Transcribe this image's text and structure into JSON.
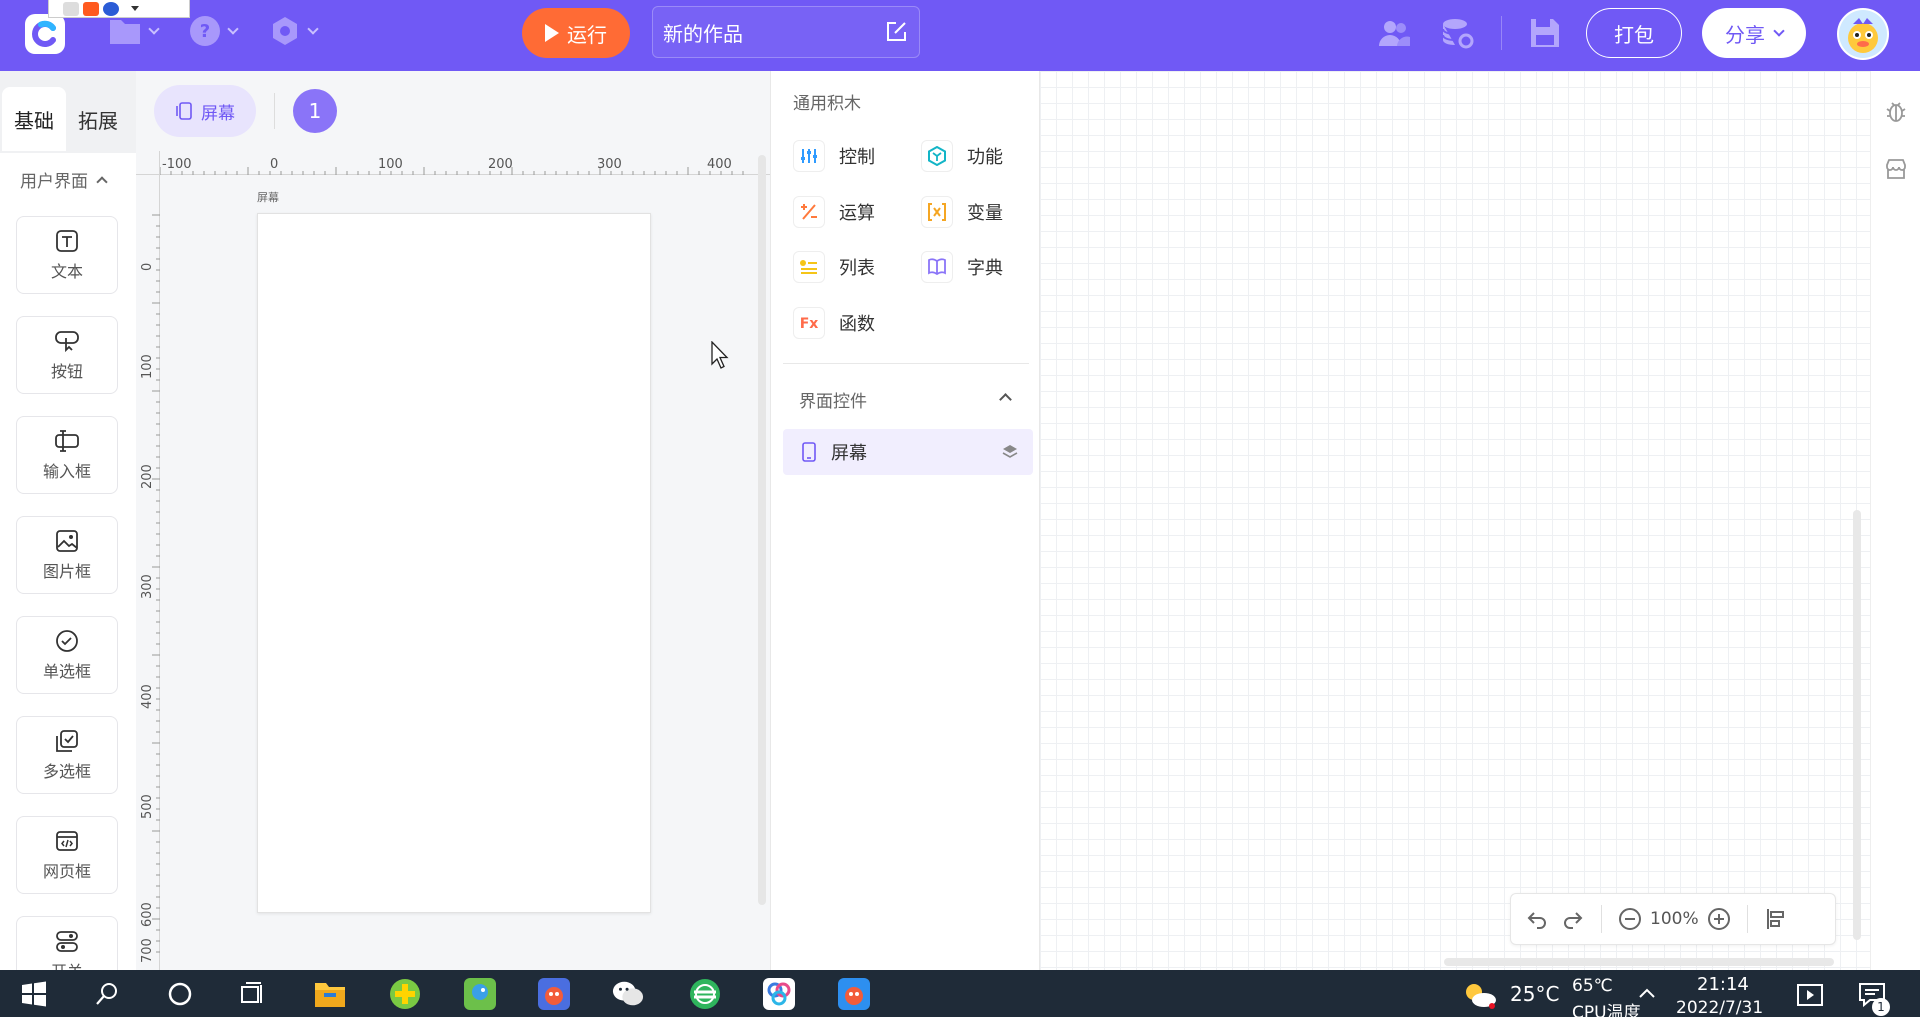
{
  "app": {
    "run_label": "运行",
    "project_name": "新的作品",
    "pack_label": "打包",
    "share_label": "分享"
  },
  "left_tabs": [
    "基础",
    "拓展"
  ],
  "left_section": "用户界面",
  "components": [
    {
      "label": "文本",
      "icon": "text-icon"
    },
    {
      "label": "按钮",
      "icon": "button-icon"
    },
    {
      "label": "输入框",
      "icon": "input-icon"
    },
    {
      "label": "图片框",
      "icon": "image-icon"
    },
    {
      "label": "单选框",
      "icon": "radio-icon"
    },
    {
      "label": "多选框",
      "icon": "checkbox-icon"
    },
    {
      "label": "网页框",
      "icon": "webview-icon"
    },
    {
      "label": "开关",
      "icon": "switch-icon"
    }
  ],
  "canvas": {
    "screen_chip": "屏幕",
    "screen_count": "1",
    "phone_caption": "屏幕",
    "h_ticks": [
      "-100",
      "0",
      "100",
      "200",
      "300",
      "400"
    ],
    "v_ticks": [
      "0",
      "100",
      "200",
      "300",
      "400",
      "500",
      "600",
      "700"
    ]
  },
  "blocks": {
    "title": "通用积木",
    "items": [
      {
        "label": "控制",
        "icon": "control-icon",
        "color": "#2f9bff"
      },
      {
        "label": "功能",
        "icon": "function-icon",
        "color": "#13b5c7"
      },
      {
        "label": "运算",
        "icon": "operator-icon",
        "color": "#ff7a3d"
      },
      {
        "label": "变量",
        "icon": "variable-icon",
        "color": "#f5a623"
      },
      {
        "label": "列表",
        "icon": "list-icon",
        "color": "#f5c518"
      },
      {
        "label": "字典",
        "icon": "dictionary-icon",
        "color": "#8a74f8"
      },
      {
        "label": "函数",
        "icon": "fx-icon",
        "color": "#ff6b4a"
      }
    ],
    "ui_section": "界面控件",
    "ui_items": [
      {
        "label": "屏幕",
        "icon": "phone-icon"
      }
    ]
  },
  "zoom": {
    "value": "100%"
  },
  "taskbar": {
    "temperature": "25°C",
    "cpu_temp": "65℃",
    "cpu_label": "CPU温度",
    "time": "21:14",
    "date": "2022/7/31",
    "notifications": "1"
  },
  "colors": {
    "brand": "#7059f5",
    "run": "#ff6b35"
  }
}
